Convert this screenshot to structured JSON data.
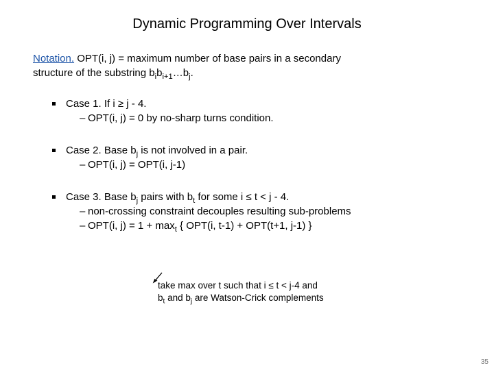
{
  "title": "Dynamic Programming Over Intervals",
  "notation": {
    "label": "Notation.",
    "text_a": "OPT(i, j) = maximum number of base pairs in a secondary",
    "text_b": "structure of the substring  b",
    "sub_i": "i",
    "b2": "b",
    "sub_i1": "i+1",
    "dots": "…b",
    "sub_j": "j",
    "period": "."
  },
  "case1": {
    "head_a": "Case 1.  If i ",
    "ge": "≥",
    "head_b": " j - 4.",
    "line1": "OPT(i, j) = 0 by no-sharp turns condition."
  },
  "case2": {
    "head_a": "Case 2.  Base b",
    "sub_j": "j",
    "head_b": " is not involved in a pair.",
    "line1": "OPT(i, j) = OPT(i, j-1)"
  },
  "case3": {
    "head_a": "Case 3.  Base b",
    "sub_j": "j",
    "head_b": " pairs with b",
    "sub_t": "t",
    "head_c": " for some i ",
    "le": "≤",
    "head_d": " t < j - 4.",
    "line1": "non-crossing constraint decouples resulting sub-problems",
    "line2_a": "OPT(i, j) = 1 + max",
    "line2_sub": "t",
    "line2_b": " { OPT(i, t-1) + OPT(t+1, j-1) }"
  },
  "footnote": {
    "l1_a": "take max over t such that i ",
    "l1_le": "≤",
    "l1_b": " t < j-4 and",
    "l2_a": "b",
    "l2_sub_t": "t",
    "l2_b": " and b",
    "l2_sub_j": "j",
    "l2_c": " are Watson-Crick complements"
  },
  "pagenum": "35"
}
